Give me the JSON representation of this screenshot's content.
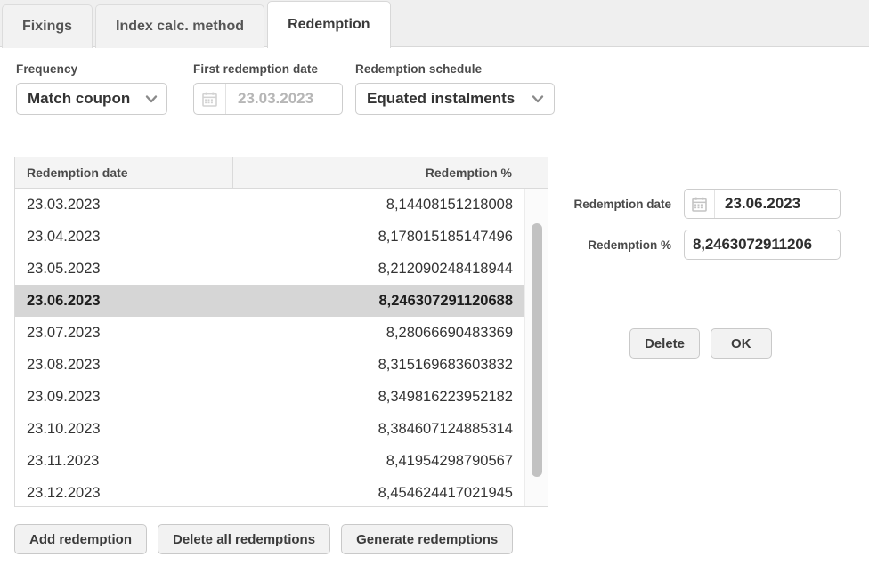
{
  "tabs": [
    {
      "label": "Fixings",
      "active": false
    },
    {
      "label": "Index calc. method",
      "active": false
    },
    {
      "label": "Redemption",
      "active": true
    }
  ],
  "form": {
    "frequency": {
      "label": "Frequency",
      "value": "Match coupon",
      "chevron_icon": "chevron-down-icon"
    },
    "first_redemption_date": {
      "label": "First redemption date",
      "value": "23.03.2023",
      "disabled": true,
      "calendar_icon": "calendar-icon"
    },
    "redemption_schedule": {
      "label": "Redemption schedule",
      "value": "Equated instalments",
      "chevron_icon": "chevron-down-icon"
    }
  },
  "table": {
    "columns": [
      "Redemption date",
      "Redemption %",
      ""
    ],
    "selected_index": 3,
    "rows": [
      {
        "date": "23.03.2023",
        "pct": "8,14408151218008"
      },
      {
        "date": "23.04.2023",
        "pct": "8,178015185147496"
      },
      {
        "date": "23.05.2023",
        "pct": "8,212090248418944"
      },
      {
        "date": "23.06.2023",
        "pct": "8,246307291120688"
      },
      {
        "date": "23.07.2023",
        "pct": "8,28066690483369"
      },
      {
        "date": "23.08.2023",
        "pct": "8,315169683603832"
      },
      {
        "date": "23.09.2023",
        "pct": "8,349816223952182"
      },
      {
        "date": "23.10.2023",
        "pct": "8,384607124885314"
      },
      {
        "date": "23.11.2023",
        "pct": "8,41954298790567"
      },
      {
        "date": "23.12.2023",
        "pct": "8,454624417021945"
      }
    ]
  },
  "detail": {
    "date_label": "Redemption date",
    "date_value": "23.06.2023",
    "date_calendar_icon": "calendar-icon",
    "pct_label": "Redemption %",
    "pct_value": "8,2463072911206",
    "delete_label": "Delete",
    "ok_label": "OK"
  },
  "bottom_actions": {
    "add": "Add redemption",
    "delete_all": "Delete all redemptions",
    "generate": "Generate redemptions"
  },
  "colors": {
    "tabstrip_bg": "#efefef",
    "active_tab_bg": "#ffffff",
    "selected_row_bg": "#d6d6d6",
    "header_bg": "#f4f4f4",
    "border": "#dadada",
    "button_bg": "#f2f2f2",
    "disabled_text": "#b6b6b6"
  }
}
